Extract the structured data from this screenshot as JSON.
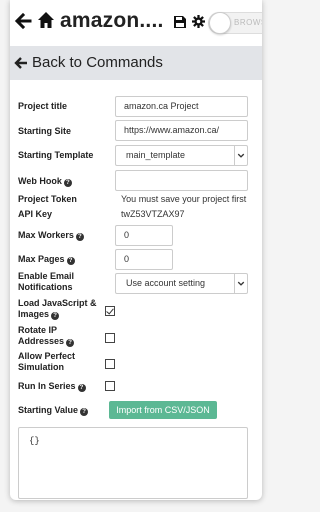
{
  "header": {
    "title": "amazon....",
    "toggle_label": "BROWSE"
  },
  "back_bar": {
    "label": "Back to Commands"
  },
  "form": {
    "project_title": {
      "label": "Project title",
      "value": "amazon.ca Project"
    },
    "starting_site": {
      "label": "Starting Site",
      "value": "https://www.amazon.ca/"
    },
    "starting_template": {
      "label": "Starting Template",
      "value": "main_template"
    },
    "web_hook": {
      "label": "Web Hook",
      "value": ""
    },
    "project_token": {
      "label": "Project Token",
      "value": "You must save your project first"
    },
    "api_key": {
      "label": "API Key",
      "value": "twZ53VTZAX97"
    },
    "max_workers": {
      "label": "Max Workers",
      "value": "0"
    },
    "max_pages": {
      "label": "Max Pages",
      "value": "0"
    },
    "enable_email": {
      "label_line1": "Enable Email",
      "label_line2": "Notifications",
      "value": "Use account setting"
    },
    "load_js": {
      "label_line1": "Load JavaScript &",
      "label_line2": "Images",
      "checked": true
    },
    "rotate_ip": {
      "label_line1": "Rotate IP",
      "label_line2": "Addresses",
      "checked": false
    },
    "perfect_sim": {
      "label_line1": "Allow Perfect",
      "label_line2": "Simulation",
      "checked": false
    },
    "run_in_series": {
      "label": "Run In Series",
      "checked": false
    },
    "starting_value": {
      "label": "Starting Value",
      "button_label": "Import from CSV/JSON",
      "value": "{}"
    }
  },
  "help_glyph": "?"
}
